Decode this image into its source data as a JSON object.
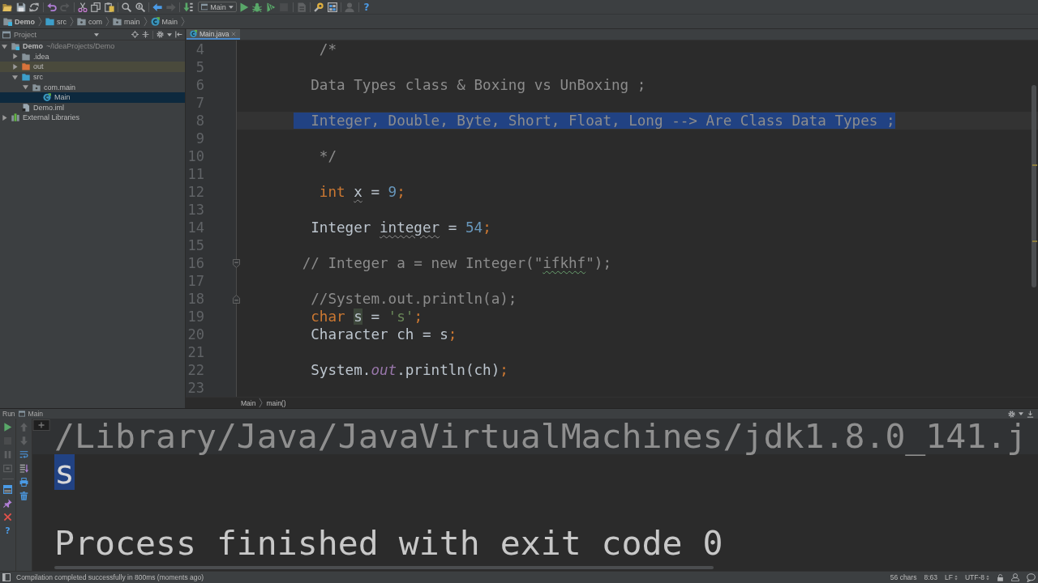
{
  "toolbar": {
    "groups": [
      [
        {
          "kind": "icon",
          "disabled": false
        },
        {
          "kind": "icon",
          "disabled": false
        },
        {
          "kind": "icon",
          "disabled": false
        }
      ],
      [
        {
          "kind": "icon",
          "disabled": false
        },
        {
          "kind": "icon",
          "disabled": true
        }
      ],
      [
        {
          "kind": "icon",
          "disabled": false
        },
        {
          "kind": "icon",
          "disabled": false
        },
        {
          "kind": "icon",
          "disabled": false
        }
      ],
      [
        {
          "kind": "icon",
          "disabled": false
        },
        {
          "kind": "icon",
          "disabled": false
        }
      ],
      [
        {
          "kind": "icon",
          "disabled": false
        },
        {
          "kind": "icon",
          "disabled": true
        }
      ],
      [
        {
          "kind": "icon",
          "disabled": false
        },
        {
          "kind": "dropdown",
          "label": "Main"
        },
        {
          "kind": "icon",
          "disabled": false
        },
        {
          "kind": "icon",
          "disabled": false
        },
        {
          "kind": "icon",
          "disabled": false
        },
        {
          "kind": "icon",
          "disabled": true
        }
      ],
      [
        {
          "kind": "icon",
          "disabled": true
        }
      ],
      [
        {
          "kind": "icon",
          "disabled": false
        },
        {
          "kind": "icon",
          "disabled": false
        }
      ],
      [
        {
          "kind": "icon",
          "disabled": true
        }
      ],
      [
        {
          "kind": "text",
          "label": "?"
        }
      ]
    ]
  },
  "navigation_bar": [
    {
      "kind": "module",
      "label": "Demo"
    },
    {
      "kind": "source-folder",
      "label": "src"
    },
    {
      "kind": "package",
      "label": "com"
    },
    {
      "kind": "package",
      "label": "main"
    },
    {
      "kind": "class",
      "label": "Main"
    }
  ],
  "project": {
    "title": "Project",
    "tree": [
      {
        "kind": "module",
        "label": "Demo",
        "path": "~/IdeaProjects/Demo",
        "expanded": true,
        "selected": false,
        "children": [
          {
            "kind": "folder",
            "label": ".idea",
            "expanded": false,
            "selected": false
          },
          {
            "kind": "excluded-folder",
            "label": "out",
            "expanded": false,
            "selected": false
          },
          {
            "kind": "source-folder",
            "label": "src",
            "expanded": true,
            "selected": false,
            "children": [
              {
                "kind": "package",
                "label": "com.main",
                "expanded": true,
                "selected": false,
                "children": [
                  {
                    "kind": "class",
                    "label": "Main",
                    "selected": true
                  }
                ]
              }
            ]
          },
          {
            "kind": "file",
            "label": "Demo.iml",
            "selected": false
          }
        ]
      },
      {
        "kind": "library",
        "label": "External Libraries",
        "expanded": false,
        "selected": false
      }
    ]
  },
  "editor": {
    "tabs": [
      {
        "label": "Main.java",
        "selected": true
      }
    ],
    "lines": [
      {
        "number": "4",
        "selected": false,
        "tokens": [
          {
            "text": "         /*",
            "kind": "comment"
          }
        ]
      },
      {
        "number": "5",
        "selected": false
      },
      {
        "number": "6",
        "selected": false,
        "tokens": [
          {
            "text": "        Data Types class & Boxing vs UnBoxing ;",
            "kind": "comment"
          }
        ]
      },
      {
        "number": "7",
        "selected": false
      },
      {
        "number": "8",
        "selected": true,
        "tokens": [
          {
            "text": "        Integer, Double, Byte, Short, Float, Long --> Are Class Data Types ;",
            "kind": "comment"
          }
        ]
      },
      {
        "number": "9",
        "selected": false
      },
      {
        "number": "10",
        "selected": false,
        "tokens": [
          {
            "text": "         */",
            "kind": "comment"
          }
        ]
      },
      {
        "number": "11",
        "selected": false
      },
      {
        "number": "12",
        "selected": false,
        "tokens": [
          {
            "text": "         int ",
            "kind": "keyword"
          },
          {
            "text": "x",
            "kind": "unused"
          },
          {
            "text": " = ",
            "kind": "plain"
          },
          {
            "text": "9",
            "kind": "number"
          },
          {
            "text": ";",
            "kind": "punct"
          }
        ]
      },
      {
        "number": "13",
        "selected": false
      },
      {
        "number": "14",
        "selected": false,
        "tokens": [
          {
            "text": "        Integer ",
            "kind": "plain"
          },
          {
            "text": "integer",
            "kind": "unused"
          },
          {
            "text": " = ",
            "kind": "plain"
          },
          {
            "text": "54",
            "kind": "number"
          },
          {
            "text": ";",
            "kind": "punct"
          }
        ]
      },
      {
        "number": "15",
        "selected": false
      },
      {
        "number": "16",
        "selected": false,
        "fold": {
          "kind": "start"
        },
        "tokens": [
          {
            "text": "       // Integer a = new Integer(\"",
            "kind": "comment"
          },
          {
            "text": "ifkhf",
            "kind": "typo"
          },
          {
            "text": "\");",
            "kind": "comment"
          }
        ]
      },
      {
        "number": "17",
        "selected": false
      },
      {
        "number": "18",
        "selected": false,
        "fold": {
          "kind": "end"
        },
        "tokens": [
          {
            "text": "        //System.out.println(a);",
            "kind": "comment"
          }
        ]
      },
      {
        "number": "19",
        "selected": false,
        "tokens": [
          {
            "text": "        char ",
            "kind": "keyword"
          },
          {
            "text": "s",
            "kind": "usage"
          },
          {
            "text": " = ",
            "kind": "plain"
          },
          {
            "text": "'s'",
            "kind": "string"
          },
          {
            "text": ";",
            "kind": "punct"
          }
        ]
      },
      {
        "number": "20",
        "selected": false,
        "tokens": [
          {
            "text": "        Character ch = s",
            "kind": "plain"
          },
          {
            "text": ";",
            "kind": "punct"
          }
        ]
      },
      {
        "number": "21",
        "selected": false
      },
      {
        "number": "22",
        "selected": false,
        "tokens": [
          {
            "text": "        System.",
            "kind": "plain"
          },
          {
            "text": "out",
            "kind": "field"
          },
          {
            "text": ".println(ch)",
            "kind": "plain"
          },
          {
            "text": ";",
            "kind": "punct"
          }
        ]
      },
      {
        "number": "23",
        "selected": false
      }
    ],
    "breadcrumbs": [
      "Main",
      "main()"
    ]
  },
  "run": {
    "title": "Run",
    "tab": "Main",
    "side_toolbar": [
      {
        "disabled": false
      },
      {
        "disabled": true
      },
      {
        "disabled": true
      },
      {
        "disabled": true
      },
      {
        "disabled": false
      },
      {
        "disabled": false
      },
      {
        "disabled": false
      }
    ],
    "help": "?",
    "console_toolbar": [
      {
        "disabled": true
      },
      {
        "disabled": true
      },
      {
        "disabled": false
      },
      {
        "disabled": false
      },
      {
        "disabled": false
      },
      {
        "disabled": false
      }
    ],
    "console": [
      {
        "kind": "command",
        "text": "/Library/Java/JavaVirtualMachines/jdk1.8.0_141.j",
        "selected": false
      },
      {
        "kind": "output",
        "text": "s",
        "selected": true
      },
      {
        "kind": "exit",
        "text": "Process finished with exit code 0",
        "selected": false
      }
    ]
  },
  "status_bar": {
    "message": "Compilation completed successfully in 800ms (moments ago)",
    "char_count": "56 chars",
    "caret_position": "8:63",
    "line_separator": "LF",
    "encoding": "UTF-8"
  }
}
